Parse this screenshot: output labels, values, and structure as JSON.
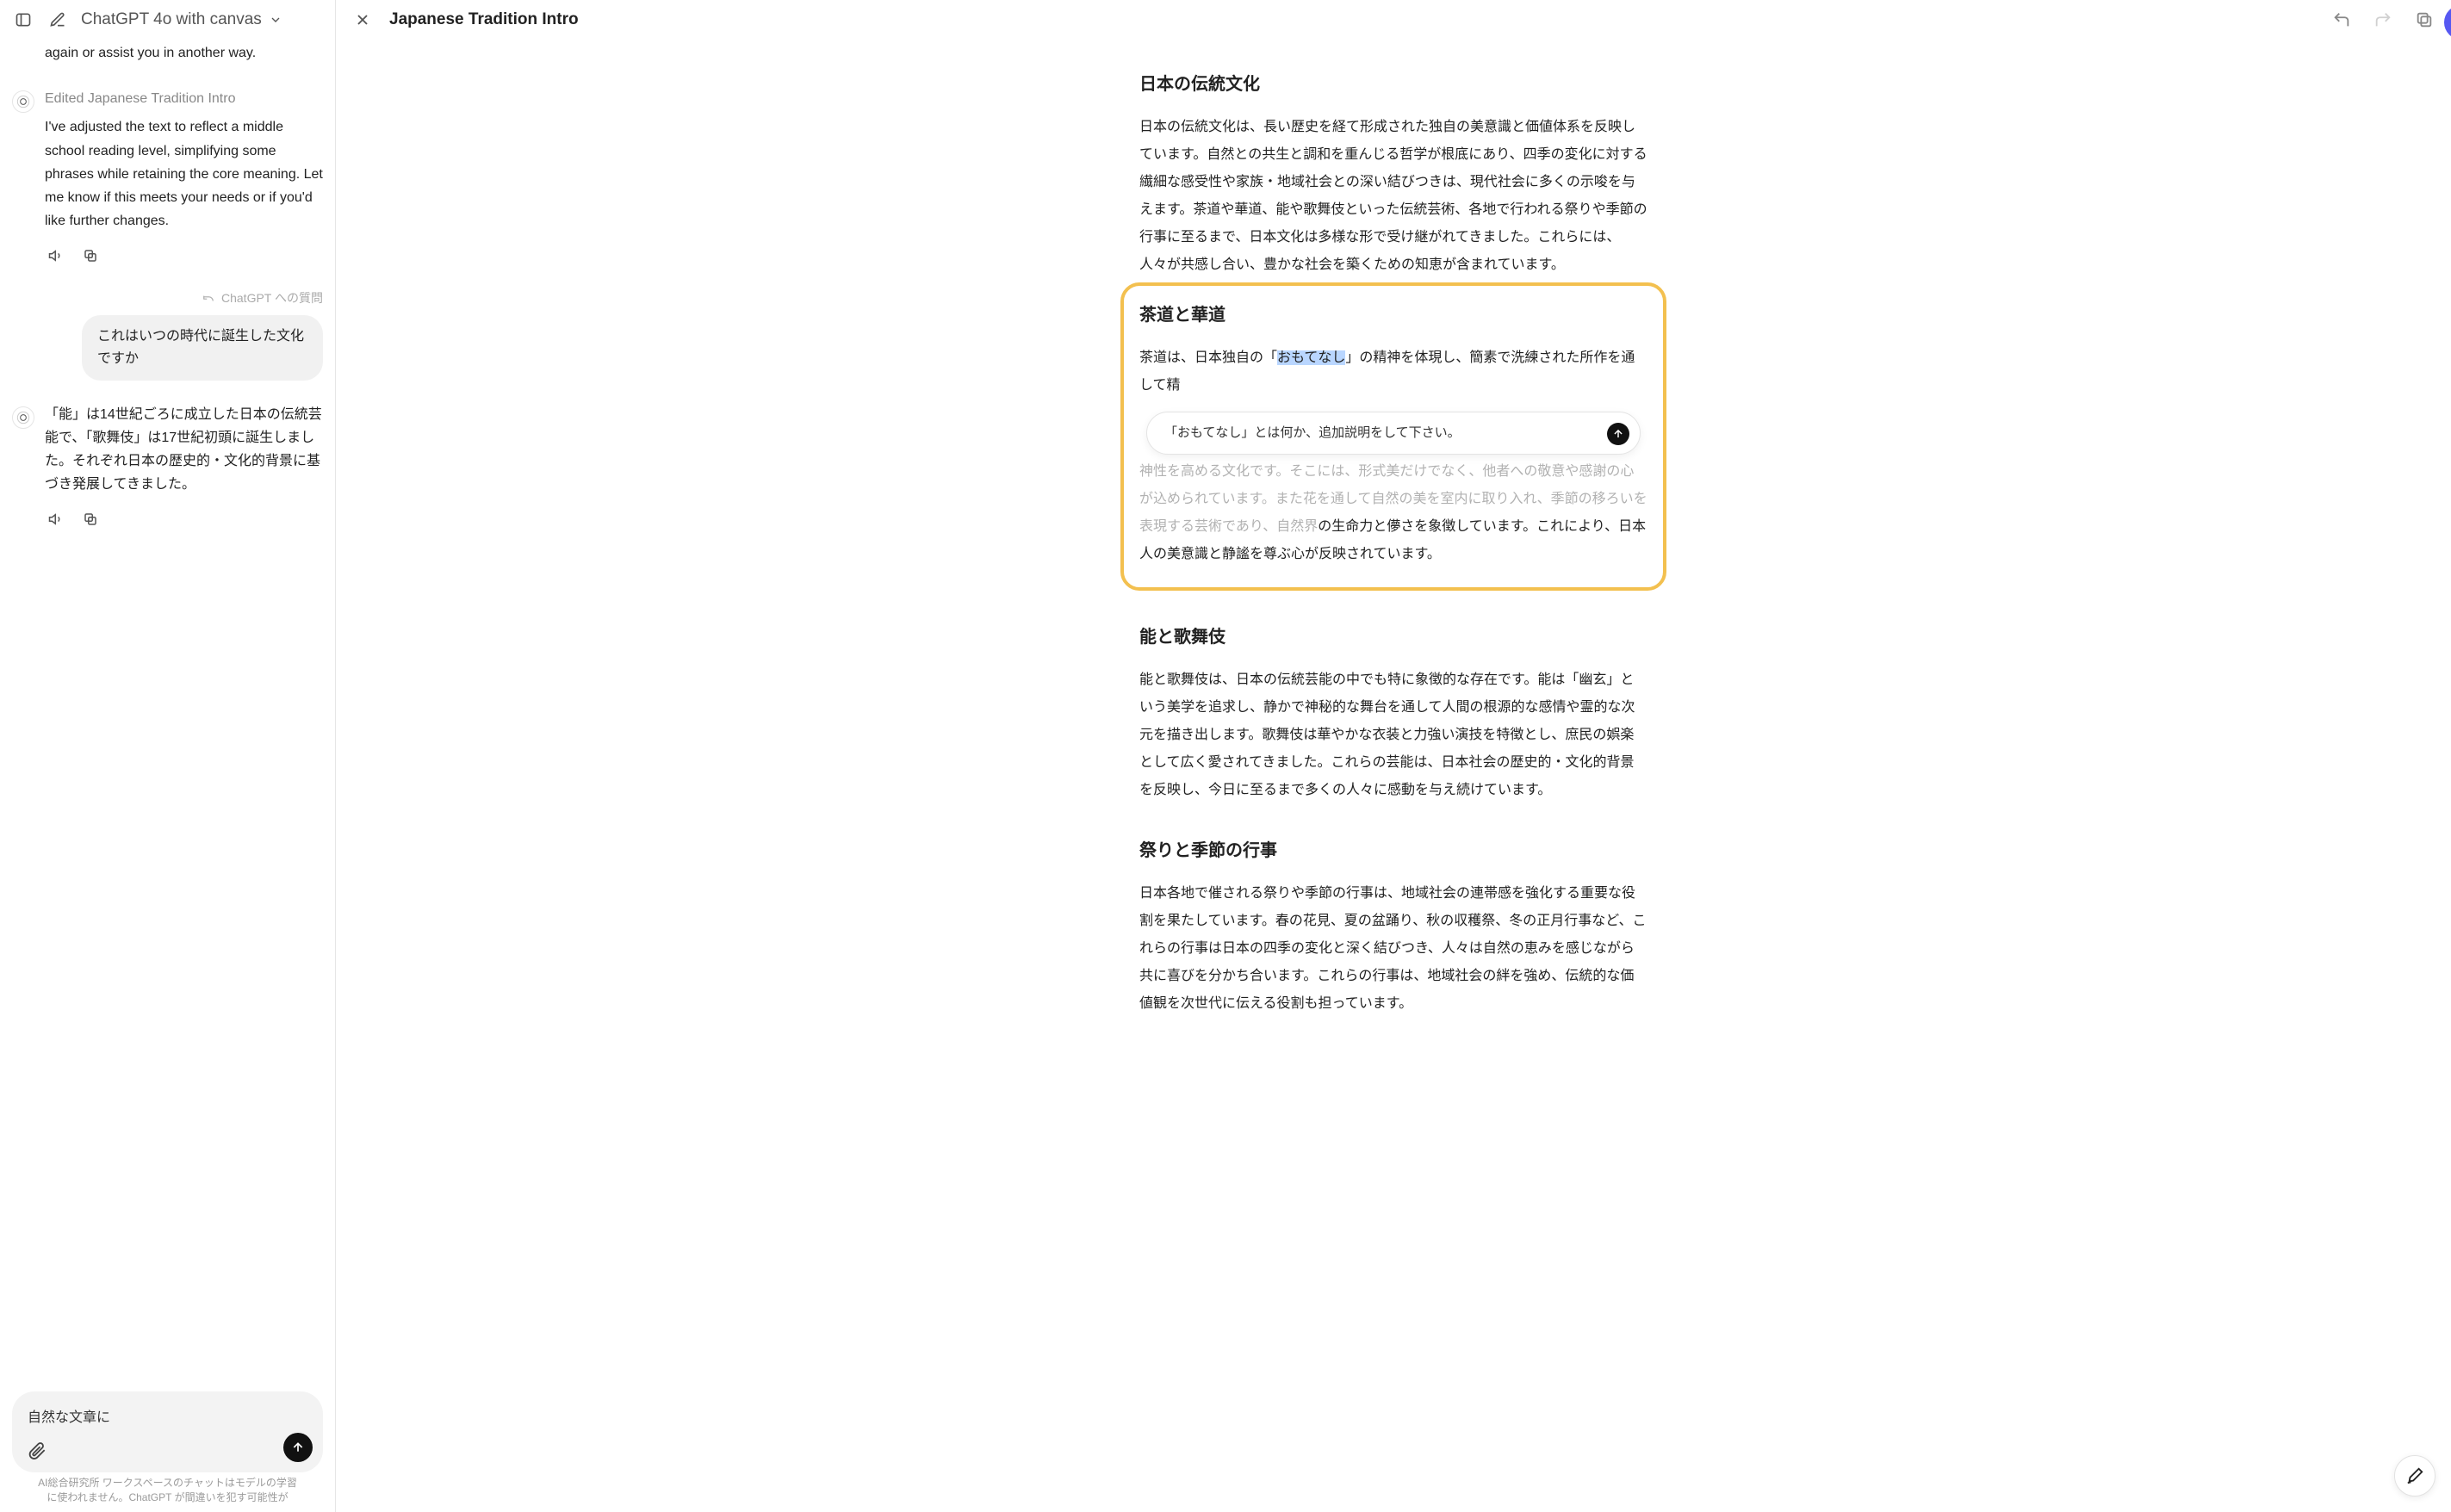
{
  "header": {
    "model_name": "ChatGPT 4o with canvas"
  },
  "chat": {
    "truncated_top": "again or assist you in another way.",
    "assistant1": {
      "edited_label": "Edited Japanese Tradition Intro",
      "body": "I've adjusted the text to reflect a middle school reading level, simplifying some phrases while retaining the core meaning. Let me know if this meets your needs or if you'd like further changes."
    },
    "suggestion_label": "ChatGPT への質問",
    "user1": "これはいつの時代に誕生した文化ですか",
    "assistant2": "「能」は14世紀ごろに成立した日本の伝統芸能で、「歌舞伎」は17世紀初頭に誕生しました。それぞれ日本の歴史的・文化的背景に基づき発展してきました。"
  },
  "composer": {
    "value": "自然な文章に"
  },
  "footer": "AI総合研究所 ワークスペースのチャットはモデルの学習に使われません。ChatGPT が間違いを犯す可能性が",
  "canvas": {
    "title": "Japanese Tradition Intro"
  },
  "doc": {
    "h1": "日本の伝統文化",
    "p1": "日本の伝統文化は、長い歴史を経て形成された独自の美意識と価値体系を反映しています。自然との共生と調和を重んじる哲学が根底にあり、四季の変化に対する繊細な感受性や家族・地域社会との深い結びつきは、現代社会に多くの示唆を与えます。茶道や華道、能や歌舞伎といった伝統芸術、各地で行われる祭りや季節の行事に至るまで、日本文化は多様な形で受け継がれてきました。これらには、人々が共感し合い、豊かな社会を築くための知恵が含まれています。",
    "h2": "茶道と華道",
    "p2_pre": "茶道は、日本独自の「",
    "p2_sel": "おもてなし",
    "p2_mid": "」の精神を体現し、簡素で洗練された所作を通して精",
    "p2_hidden": "神性を高める文化です。そこには、形式美だけでなく、他者への敬意や感謝の心が込められています。また花を通して自然の美を室内に取り入れ、季節の移ろいを表現する芸術であり、自然界",
    "p2_post": "の生命力と儚さを象徴しています。これにより、日本人の美意識と静謐を尊ぶ心が反映されています。",
    "inline_prompt": "「おもてなし」とは何か、追加説明をして下さい。",
    "h3": "能と歌舞伎",
    "p3": "能と歌舞伎は、日本の伝統芸能の中でも特に象徴的な存在です。能は「幽玄」という美学を追求し、静かで神秘的な舞台を通して人間の根源的な感情や霊的な次元を描き出します。歌舞伎は華やかな衣装と力強い演技を特徴とし、庶民の娯楽として広く愛されてきました。これらの芸能は、日本社会の歴史的・文化的背景を反映し、今日に至るまで多くの人々に感動を与え続けています。",
    "h4": "祭りと季節の行事",
    "p4": "日本各地で催される祭りや季節の行事は、地域社会の連帯感を強化する重要な役割を果たしています。春の花見、夏の盆踊り、秋の収穫祭、冬の正月行事など、これらの行事は日本の四季の変化と深く結びつき、人々は自然の恵みを感じながら共に喜びを分かち合います。これらの行事は、地域社会の絆を強め、伝統的な価値観を次世代に伝える役割も担っています。"
  }
}
